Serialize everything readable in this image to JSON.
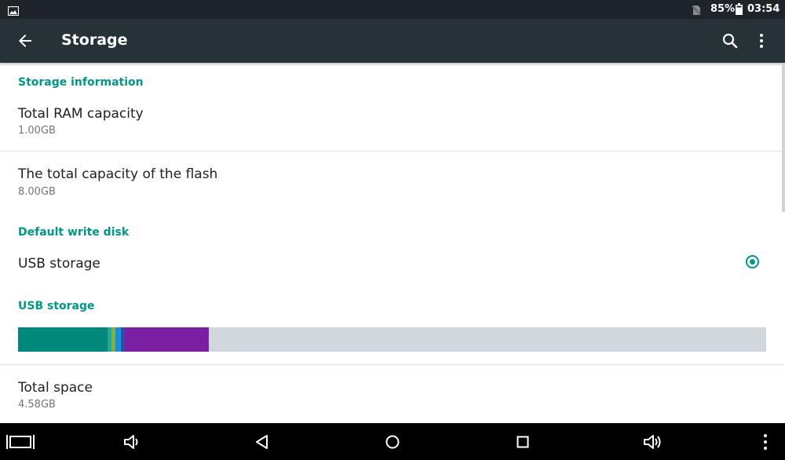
{
  "status_bar": {
    "battery": "85%",
    "time": "03:54"
  },
  "app_bar": {
    "title": "Storage",
    "icons": [
      "back-arrow",
      "search",
      "more-vert"
    ]
  },
  "storage_information": {
    "header": "Storage information",
    "ram": {
      "title": "Total RAM capacity",
      "value": "1.00GB"
    },
    "flash": {
      "title": "The total capacity of the flash",
      "value": "8.00GB"
    }
  },
  "default_write_disk": {
    "header": "Default write disk",
    "option": {
      "label": "USB storage",
      "selected": true
    }
  },
  "usb_storage": {
    "header": "USB storage",
    "usage_segments": [
      {
        "color": "#00897b",
        "fraction": 0.12
      },
      {
        "color": "#26a69a",
        "fraction": 0.005
      },
      {
        "color": "#7cb342",
        "fraction": 0.005
      },
      {
        "color": "#1e88e5",
        "fraction": 0.005
      },
      {
        "color": "#00acc1",
        "fraction": 0.002
      },
      {
        "color": "#3949ab",
        "fraction": 0.006
      },
      {
        "color": "#7b1fa2",
        "fraction": 0.112
      }
    ],
    "free_color": "#cfd8dc",
    "total_space": {
      "title": "Total space",
      "value": "4.58GB"
    }
  },
  "colors": {
    "accent": "#009688",
    "status_bar": "#1f242b",
    "app_bar": "#263238"
  },
  "nav_bar": {
    "buttons": [
      "screenshot",
      "volume-down",
      "back",
      "home",
      "recents",
      "volume-up",
      "menu"
    ]
  }
}
